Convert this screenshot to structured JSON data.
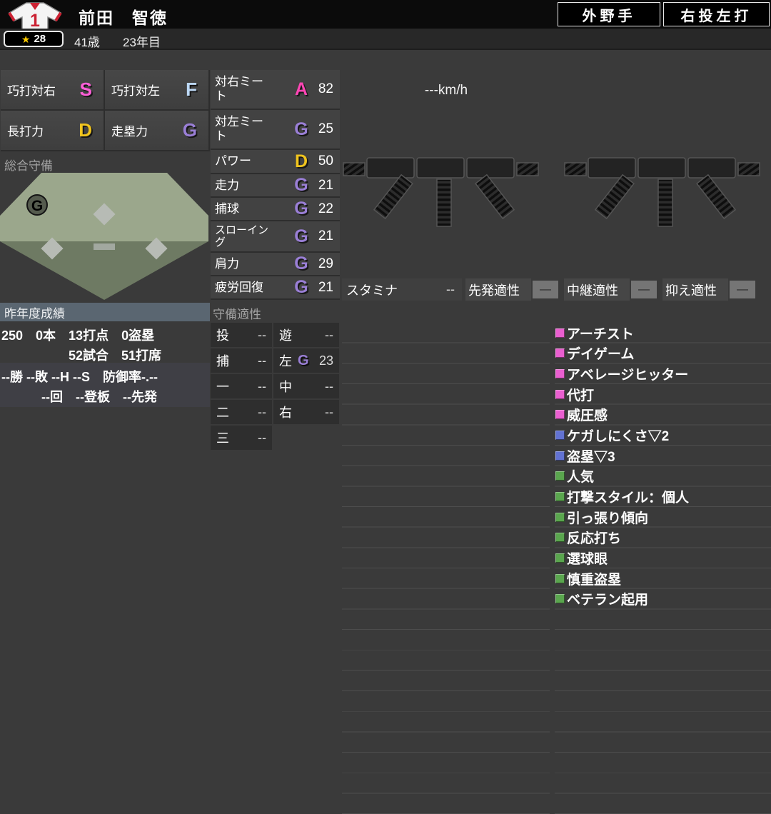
{
  "header": {
    "jersey_number": "1",
    "player_name": "前田　智徳",
    "position_button": "外野手",
    "throw_bat_button": "右投左打",
    "star_icon": "★",
    "star_count": "28",
    "age": "41歳",
    "year": "23年目"
  },
  "ability_grid": [
    {
      "label": "巧打対右",
      "grade": "S",
      "color": "#ff5fd8"
    },
    {
      "label": "巧打対左",
      "grade": "F",
      "color": "#bcd8f5"
    },
    {
      "label": "長打力",
      "grade": "D",
      "color": "#f0c41e"
    },
    {
      "label": "走塁力",
      "grade": "G",
      "color": "#9a7fd6"
    }
  ],
  "overall_defense": {
    "title": "総合守備",
    "grade": "G",
    "grade_color": "#a583e8"
  },
  "batting_stats": [
    {
      "label": "対右ミート",
      "grade": "A",
      "color": "#ff46b4",
      "value": "82"
    },
    {
      "label": "対左ミート",
      "grade": "G",
      "color": "#9a7fd6",
      "value": "25"
    },
    {
      "label": "パワー",
      "grade": "D",
      "color": "#f0c41e",
      "value": "50"
    },
    {
      "label": "走力",
      "grade": "G",
      "color": "#9a7fd6",
      "value": "21"
    },
    {
      "label": "捕球",
      "grade": "G",
      "color": "#9a7fd6",
      "value": "22"
    },
    {
      "label": "スローイング",
      "grade": "G",
      "color": "#9a7fd6",
      "value": "21"
    },
    {
      "label": "肩力",
      "grade": "G",
      "color": "#9a7fd6",
      "value": "29"
    },
    {
      "label": "疲労回復",
      "grade": "G",
      "color": "#9a7fd6",
      "value": "21"
    }
  ],
  "speed": "---km/h",
  "stamina_row": {
    "stamina_label": "スタミナ",
    "stamina_value": "--",
    "aptitudes": [
      {
        "label": "先発適性",
        "value": "—"
      },
      {
        "label": "中継適性",
        "value": "—"
      },
      {
        "label": "抑え適性",
        "value": "—"
      }
    ]
  },
  "defense_aptitude": {
    "title": "守備適性",
    "col1": [
      {
        "pos": "投",
        "value": "--"
      },
      {
        "pos": "捕",
        "value": "--"
      },
      {
        "pos": "一",
        "value": "--"
      },
      {
        "pos": "二",
        "value": "--"
      },
      {
        "pos": "三",
        "value": "--"
      }
    ],
    "col2": [
      {
        "pos": "遊",
        "value": "--"
      },
      {
        "pos": "左",
        "grade": "G",
        "grade_color": "#9a7fd6",
        "value": "23"
      },
      {
        "pos": "中",
        "value": "--"
      },
      {
        "pos": "右",
        "value": "--"
      }
    ]
  },
  "last_year": {
    "title": "昨年度成績",
    "line1": "250　0本　13打点　0盗塁",
    "line2": "52試合　51打席",
    "line3": "--勝 --敗 --H --S　防御率-.--",
    "line4": "--回　--登板　--先発"
  },
  "special_abilities": [
    {
      "label": "アーチスト",
      "color": "#ea5fd0"
    },
    {
      "label": "デイゲーム",
      "color": "#ea5fd0"
    },
    {
      "label": "アベレージヒッター",
      "color": "#ea5fd0"
    },
    {
      "label": "代打",
      "color": "#ea5fd0"
    },
    {
      "label": "威圧感",
      "color": "#ea5fd0"
    },
    {
      "label": "ケガしにくさ▽2",
      "color": "#6272d2"
    },
    {
      "label": "盗塁▽3",
      "color": "#6272d2"
    },
    {
      "label": "人気",
      "color": "#5aa64e"
    },
    {
      "label": "打撃スタイル：個人",
      "color": "#5aa64e"
    },
    {
      "label": "引っ張り傾向",
      "color": "#5aa64e"
    },
    {
      "label": "反応打ち",
      "color": "#5aa64e"
    },
    {
      "label": "選球眼",
      "color": "#5aa64e"
    },
    {
      "label": "慎重盗塁",
      "color": "#5aa64e"
    },
    {
      "label": "ベテラン起用",
      "color": "#5aa64e"
    }
  ]
}
